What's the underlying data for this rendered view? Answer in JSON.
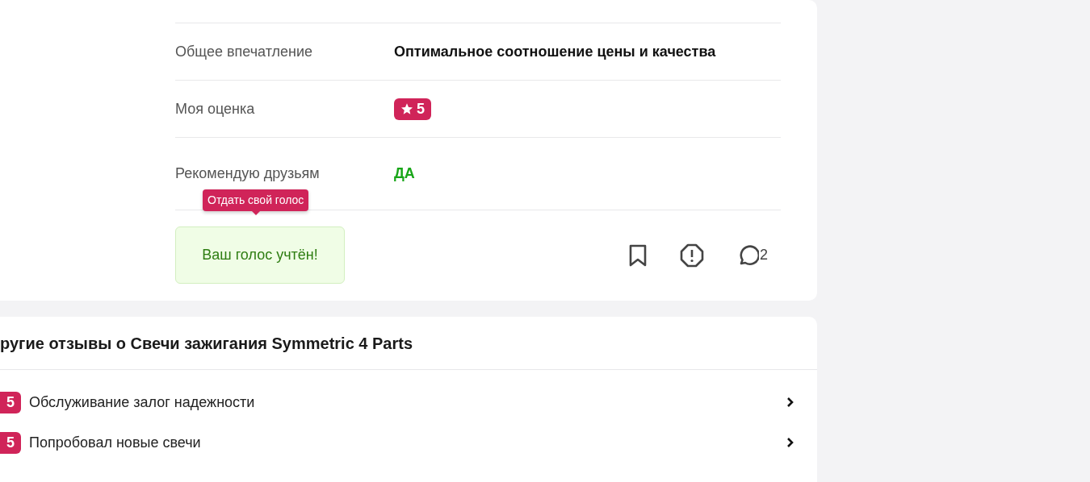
{
  "specs": [
    {
      "label": "Общее впечатление",
      "value": "Оптимальное соотношение цены и качества",
      "kind": "text"
    },
    {
      "label": "Моя оценка",
      "value": "5",
      "kind": "rating"
    },
    {
      "label": "Рекомендую друзьям",
      "value": "ДА",
      "kind": "recommend"
    }
  ],
  "tooltip": "Отдать свой голос",
  "vote_status": "Ваш голос учтён!",
  "comments_count": "2",
  "other_reviews": {
    "title": "ругие отзывы о Свечи зажигания Symmetric 4 Parts",
    "items": [
      {
        "rating": "5",
        "title": "Обслуживание залог надежности"
      },
      {
        "rating": "5",
        "title": "Попробовал новые свечи"
      }
    ]
  }
}
